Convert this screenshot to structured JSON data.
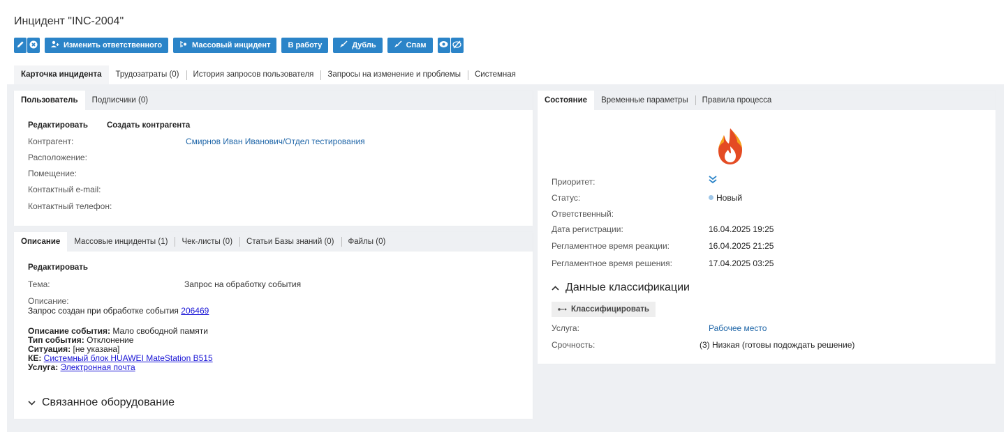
{
  "title": "Инцидент \"INC-2004\"",
  "toolbar": {
    "edit_icon": "pencil-icon",
    "close_icon": "close-circle-icon",
    "change_responsible": "Изменить ответственного",
    "change_responsible_icon": "user-add-icon",
    "mass_incident": "Массовый инцидент",
    "mass_incident_icon": "link-icon",
    "to_work": "В работу",
    "duplicate": "Дубль",
    "duplicate_icon": "broom-icon",
    "spam": "Спам",
    "spam_icon": "broom-icon",
    "watch_icon": "eye-icon",
    "unwatch_icon": "eye-off-icon",
    "accent": "#2b84c8"
  },
  "main_tabs": [
    "Карточка инцидента",
    "Трудозатраты (0)",
    "История запросов пользователя",
    "Запросы на изменение и проблемы",
    "Системная"
  ],
  "user_card": {
    "tabs": [
      "Пользователь",
      "Подписчики (0)"
    ],
    "actions": [
      "Редактировать",
      "Создать контрагента"
    ],
    "labels": [
      "Контрагент:",
      "Расположение:",
      "Помещение:",
      "Контактный e-mail:",
      "Контактный телефон:"
    ],
    "contractor": "Смирнов Иван Иванович/Отдел тестирования"
  },
  "desc_card": {
    "tabs": [
      "Описание",
      "Массовые инциденты (1)",
      "Чек-листы (0)",
      "Статьи Базы знаний (0)",
      "Файлы (0)"
    ],
    "edit": "Редактировать",
    "subject_label": "Тема:",
    "subject_value": "Запрос на обработку события",
    "description_label": "Описание:",
    "created_text": "Запрос создан при обработке события",
    "event_id": "206469",
    "event_desc_label": "Описание события:",
    "event_desc_value": "Мало свободной памяти",
    "event_type_label": "Тип события:",
    "event_type_value": "Отклонение",
    "situation_label": "Ситуация:",
    "situation_value": "[не указана]",
    "ke_label": "КЕ:",
    "ke_value": "Системный блок HUAWEI MateStation B515",
    "service_label": "Услуга:",
    "service_value": "Электронная почта",
    "related_section": "Связанное оборудование"
  },
  "state_card": {
    "tabs": [
      "Состояние",
      "Временные параметры",
      "Правила процесса"
    ],
    "icon": "fire-icon",
    "priority_label": "Приоритет:",
    "priority_icon": "chevrons-down-icon",
    "status_label": "Статус:",
    "status_value": "Новый",
    "responsible_label": "Ответственный:",
    "reg_date_label": "Дата регистрации:",
    "reg_date_value": "16.04.2025 19:25",
    "reaction_label": "Регламентное время реакции:",
    "reaction_value": "16.04.2025 21:25",
    "solution_label": "Регламентное время решения:",
    "solution_value": "17.04.2025 03:25",
    "classification_section": "Данные классификации",
    "classify_button": "Классифицировать",
    "service_label": "Услуга:",
    "service_value": "Рабочее место",
    "urgency_label": "Срочность:",
    "urgency_value": "(3) Низкая (готовы подождать решение)"
  }
}
